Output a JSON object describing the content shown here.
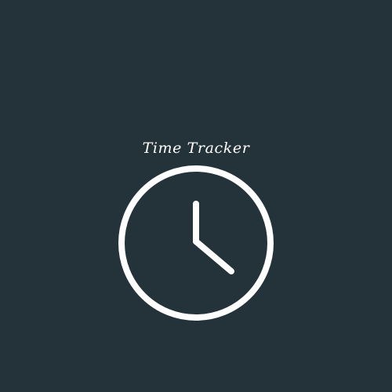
{
  "app": {
    "title": "Time Tracker"
  },
  "clock": {
    "icon": "clock-icon"
  },
  "colors": {
    "background": "#243239",
    "foreground": "#ffffff"
  }
}
